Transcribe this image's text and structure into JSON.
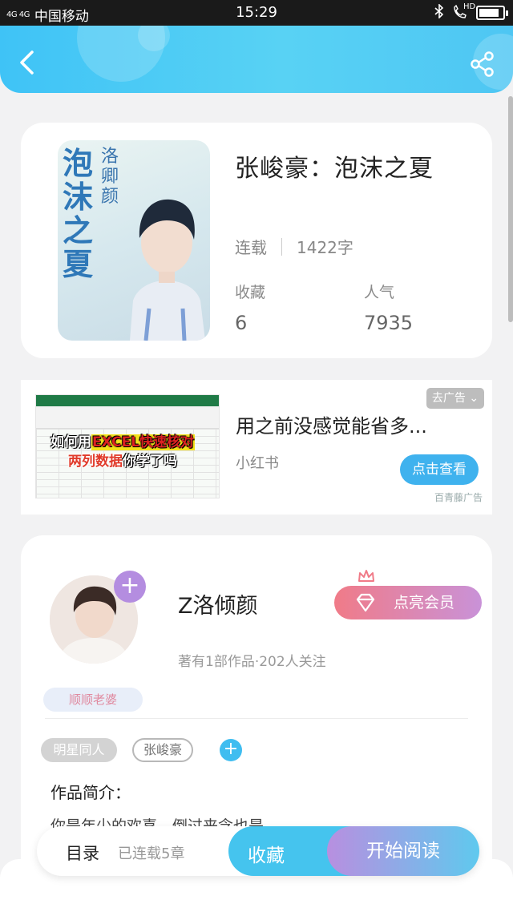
{
  "status_bar": {
    "signal": "4G 4G",
    "carrier": "中国移动",
    "time": "15:29",
    "right_icons": [
      "bluetooth-icon",
      "hd-call-icon",
      "battery-icon"
    ],
    "hd_label": "HD",
    "battery_level": 0.85
  },
  "header": {
    "back_icon": "chevron-left-icon",
    "share_icon": "share-icon"
  },
  "book": {
    "cover_title": "泡沫之夏",
    "cover_author": "洛卿颜",
    "title": "张峻豪：泡沫之夏",
    "status": "连载",
    "word_count": "1422字",
    "favorites_label": "收藏",
    "favorites_value": "6",
    "popularity_label": "人气",
    "popularity_value": "7935"
  },
  "ad": {
    "image_line1_a": "如何用",
    "image_line1_hl": "EXCEL快速核对",
    "image_line2_a": "两列数据",
    "image_line2_b": "你学了吗",
    "title": "用之前没感觉能省多...",
    "source": "小红书",
    "close_label": "去广告",
    "cta_label": "点击查看",
    "mark": "百青藤广告"
  },
  "author": {
    "name": "Z洛倾颜",
    "vip_label": "点亮会员",
    "meta": "著有1部作品·202人关注",
    "badge": "顺顺老婆",
    "tags": [
      "明星同人",
      "张峻豪"
    ],
    "intro_heading": "作品简介：",
    "intro_text": "你是年少的欢喜，倒过来念也是"
  },
  "bottom_bar": {
    "toc_label": "目录",
    "chapters_label": "已连载5章",
    "favorite_label": "收藏",
    "read_label": "开始阅读"
  },
  "colors": {
    "header": "#4ec6f3",
    "accent": "#45c4ee",
    "vip": "#f07b88",
    "avatar_plus": "#b48de0"
  }
}
